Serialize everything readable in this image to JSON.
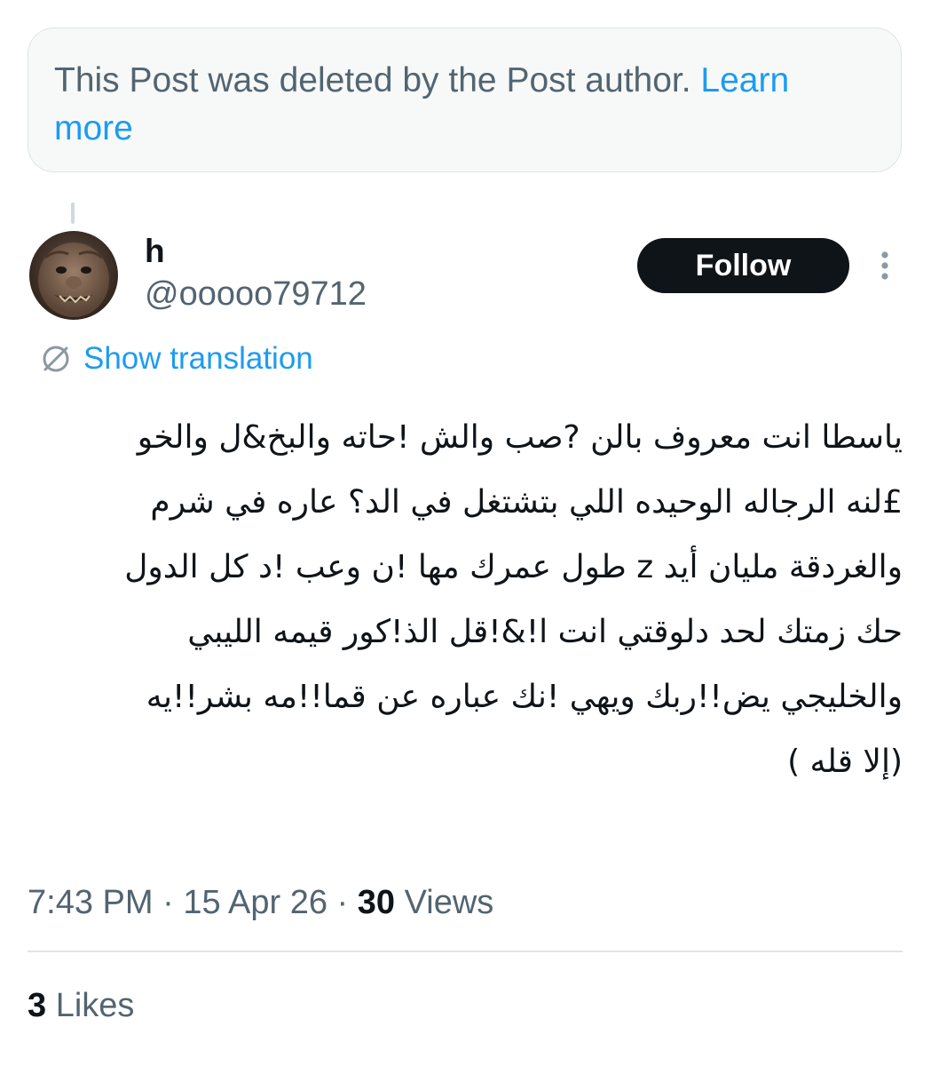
{
  "deleted_notice": {
    "text": "This Post was deleted by the Post author.",
    "link_label": "Learn more"
  },
  "author": {
    "display_name": "h",
    "handle": "@ooooo79712",
    "avatar_icon": "avatar-photo-creature-face"
  },
  "actions": {
    "follow_label": "Follow",
    "more_icon": "more-vertical-icon"
  },
  "translation": {
    "icon": "translate-globe-icon",
    "label": "Show translation"
  },
  "post": {
    "text_lines": [
      "ياسطا انت معروف بالن ?صب والش !حاته والبخ&ل والخو",
      "£لنه الرجاله الوحيده اللي بتشتغل في الد؟ عاره في شرم",
      "والغردقة مليان  أيد z طول عمرك مها !ن وعب !د كل الدول",
      "حك زمتك لحد دلوقتي انت ا!&!قل الذ!كور قيمه الليبي",
      "والخليجي يض!!ربك ويهي !نك عباره عن قما!!مه بشر!!يه",
      "(إلا قله )"
    ]
  },
  "meta": {
    "time": "7:43 PM",
    "separator": " · ",
    "date": "15 Apr 26",
    "views_count": "30",
    "views_label": " Views"
  },
  "engagement": {
    "likes_count": "3",
    "likes_label": " Likes"
  },
  "colors": {
    "accent": "#1d9bf0",
    "text_primary": "#0f1419",
    "text_secondary": "#536471",
    "notice_bg": "#f7f9f9",
    "border": "#dfe4e7",
    "follow_bg": "#0f1419"
  }
}
